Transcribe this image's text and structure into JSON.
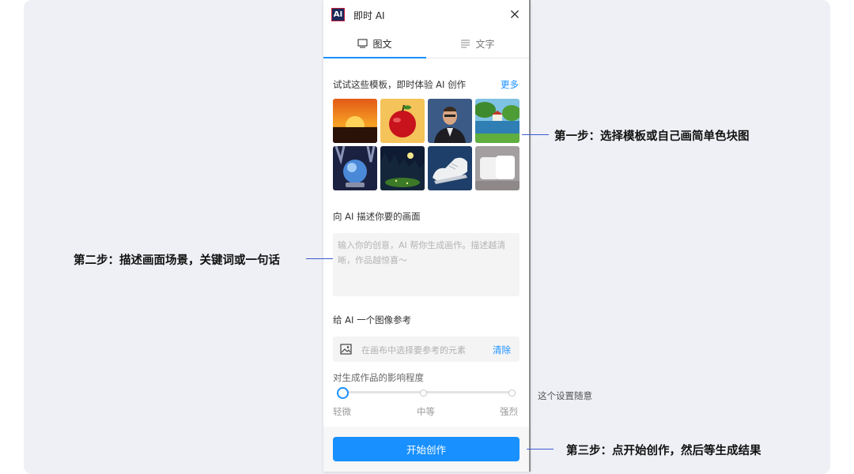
{
  "app": {
    "title": "即时 AI",
    "logo_text": "AI"
  },
  "tabs": [
    {
      "label": "图文",
      "icon": "monitor-icon",
      "active": true
    },
    {
      "label": "文字",
      "icon": "lines-icon",
      "active": false
    }
  ],
  "templates": {
    "heading": "试试这些模板，即时体验 AI 创作",
    "more_label": "更多",
    "items": [
      {
        "name": "sunset",
        "icon": "sunset-thumbnail"
      },
      {
        "name": "apple",
        "icon": "apple-thumbnail"
      },
      {
        "name": "man-portrait",
        "icon": "portrait-thumbnail"
      },
      {
        "name": "lake-landscape",
        "icon": "lake-thumbnail"
      },
      {
        "name": "crystal-ball",
        "icon": "crystal-ball-thumbnail"
      },
      {
        "name": "night-scene",
        "icon": "night-thumbnail"
      },
      {
        "name": "sneaker",
        "icon": "shoe-thumbnail"
      },
      {
        "name": "pillows",
        "icon": "pillow-thumbnail"
      }
    ]
  },
  "prompt": {
    "heading": "向 AI 描述你要的画面",
    "placeholder": "输入你的创意，AI 帮你生成画作。描述越清晰，作品越惊喜～"
  },
  "reference": {
    "heading": "给 AI 一个图像参考",
    "placeholder": "在画布中选择要参考的元素",
    "clear_label": "清除"
  },
  "influence": {
    "heading": "对生成作品的影响程度",
    "labels": [
      "轻微",
      "中等",
      "强烈"
    ],
    "selected": "轻微"
  },
  "start_button": "开始创作",
  "annotations": {
    "step1": "第一步：选择模板或自己画简单色块图",
    "step2": "第二步：描述画面场景，关键词或一句话",
    "note": "这个设置随意",
    "step3": "第三步：点开始创作，然后等生成结果"
  },
  "colors": {
    "accent": "#1890ff",
    "stage_bg": "#eef0f5",
    "panel_bg": "#f7f7f8",
    "leader_line": "#3a5bd0"
  }
}
